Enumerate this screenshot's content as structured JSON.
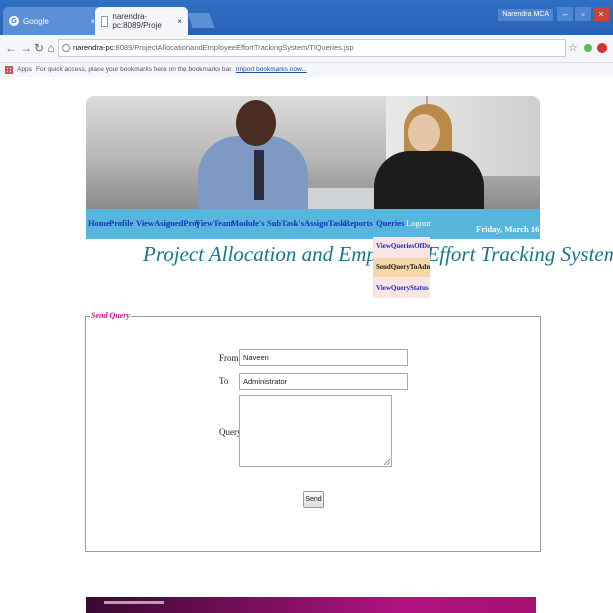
{
  "browser": {
    "tabs": [
      {
        "title": "Google",
        "active": false
      },
      {
        "title": "narendra-pc:8089/Proje",
        "active": true
      }
    ],
    "window_user": "Narendra MCA",
    "url_host": "narendra-pc",
    "url_path": ":8089/ProjectAllocationandEmployeeEffortTrackingSystem/TlQueries.jsp",
    "apps_label": "Apps",
    "bookmarks_message": "For quick access, place your bookmarks here on the bookmarks bar.",
    "bookmarks_link": "Import bookmarks now..."
  },
  "menu": {
    "items": [
      "Home",
      "Profile",
      "ViewAsignedProj",
      "ViewTeam",
      "Module's",
      "SubTask's",
      "AssignTask",
      "Reports",
      "Queries",
      "Logout"
    ],
    "date": "Friday, March 16"
  },
  "page_title": "Project Allocation and Employee Effort Tracking System",
  "queries_dropdown": [
    "ViewQueriesOfDev",
    "SendQueryToAdmin",
    "ViewQueryStatus"
  ],
  "form": {
    "legend": "Send Query",
    "from_label": "From",
    "from_value": "Naveen",
    "to_label": "To",
    "to_value": "Administrator",
    "query_label": "Query",
    "query_value": "",
    "send_label": "Send"
  },
  "colors": {
    "menu_bar": "#56b6dd",
    "menu_link": "#1a2fbf",
    "title": "#17768a",
    "legend": "#d4148c",
    "dropdown_bg": "#fbe4e4",
    "dropdown_highlight": "#f6d8a8"
  }
}
